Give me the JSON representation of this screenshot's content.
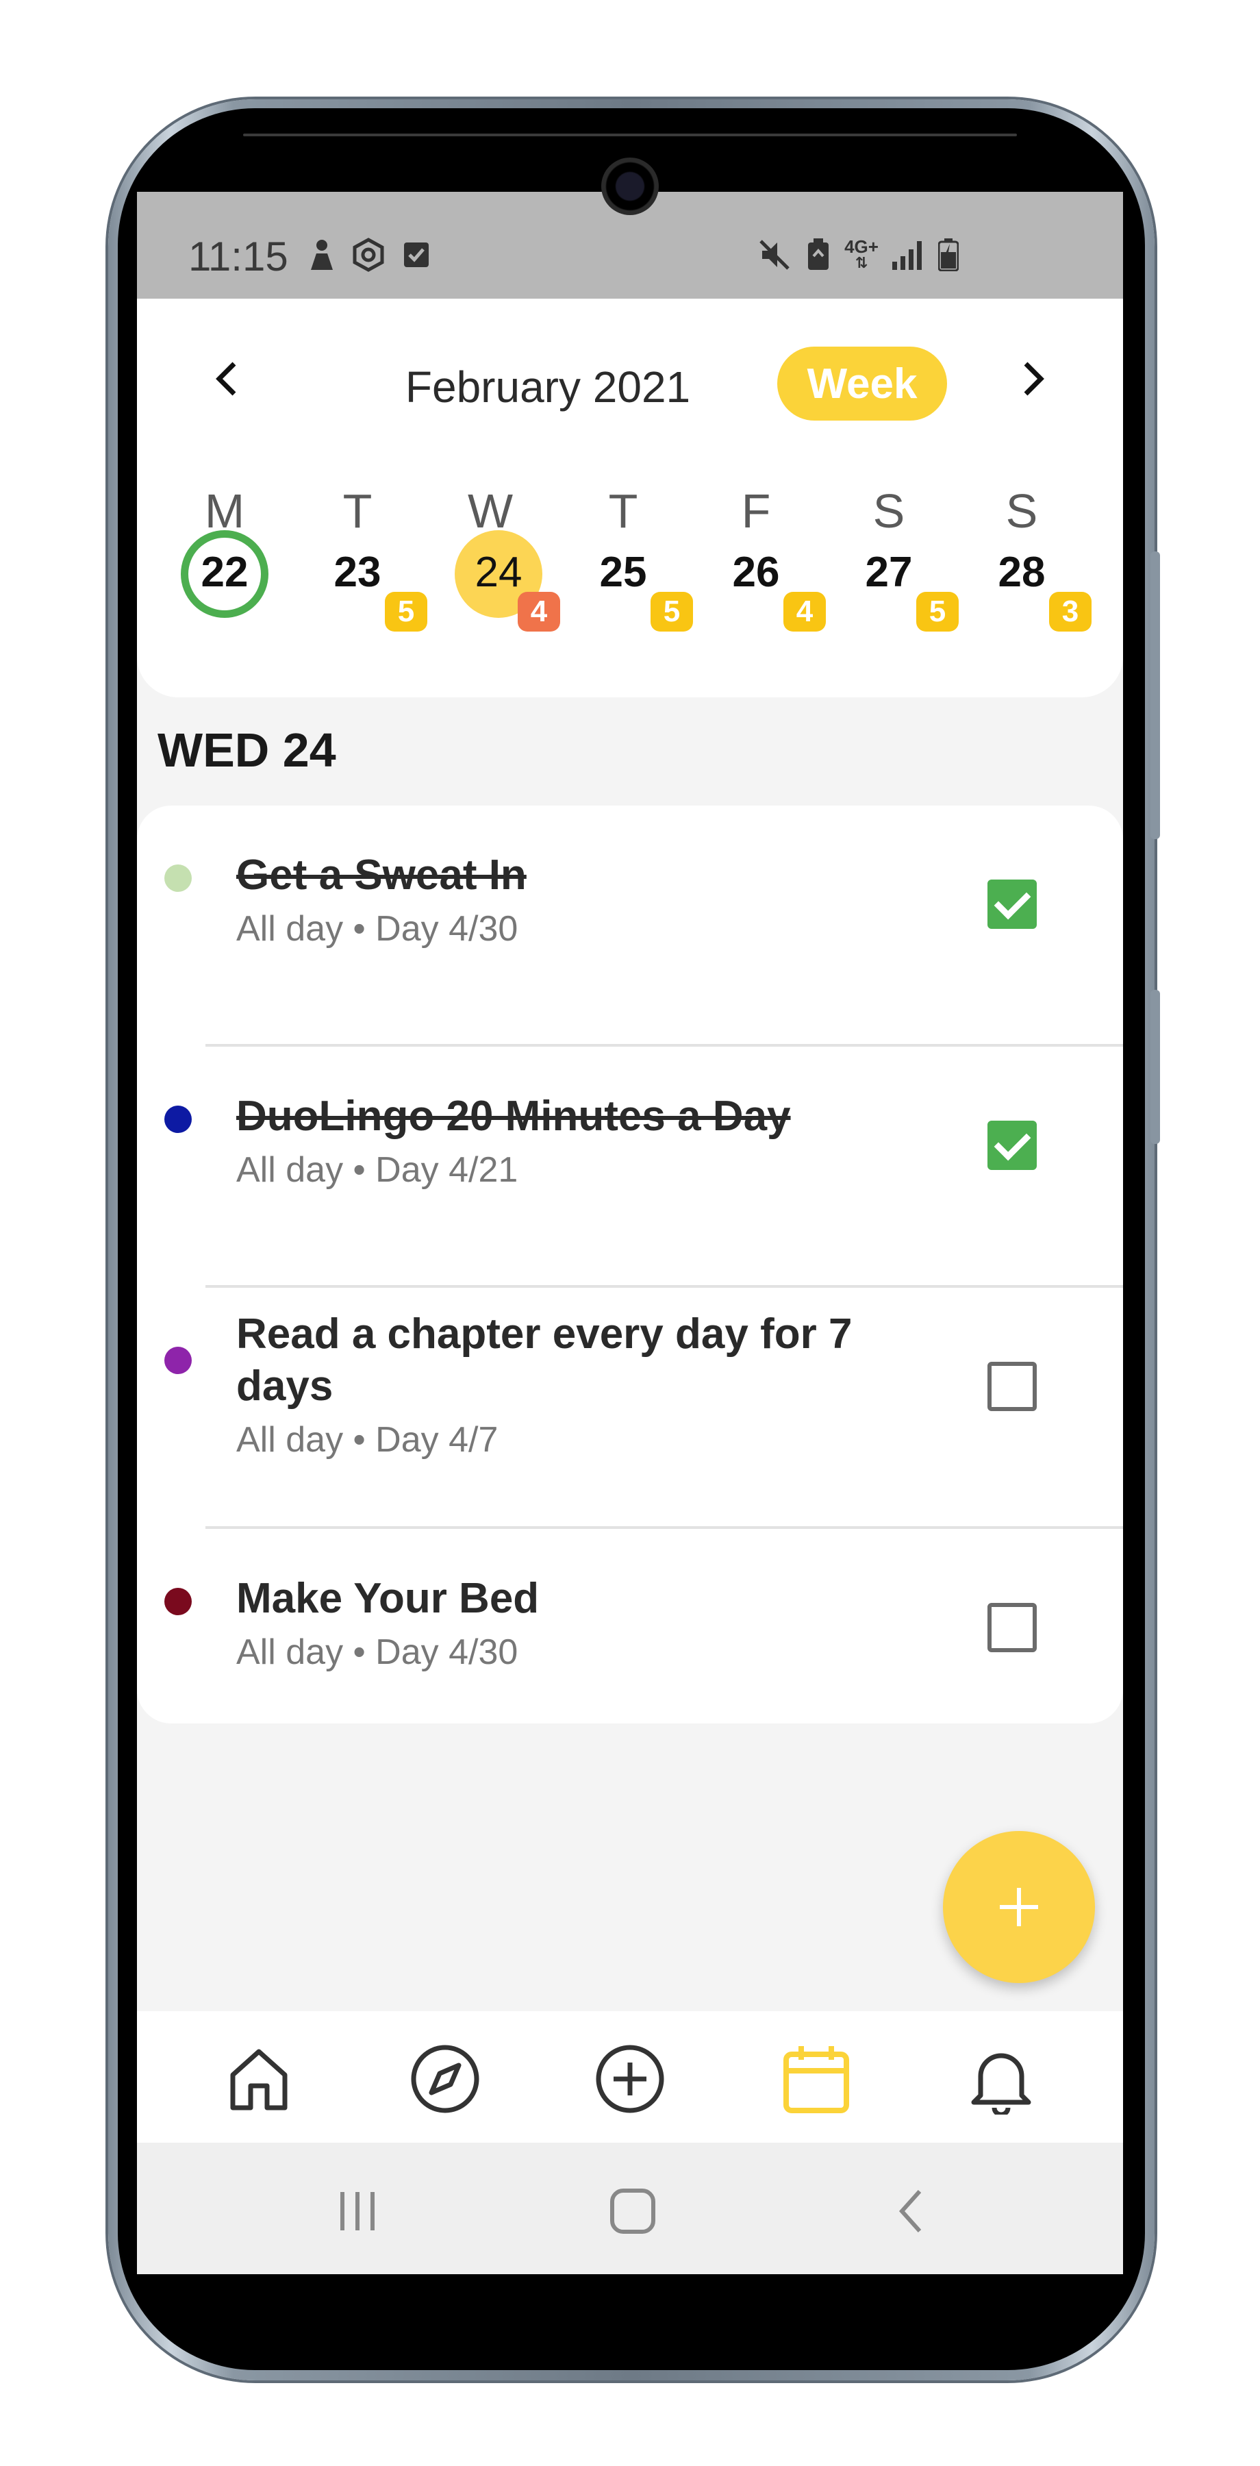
{
  "status_bar": {
    "time": "11:15",
    "left_icons": [
      "person-alert-icon",
      "hexagon-settings-icon",
      "checkbox-icon"
    ],
    "right_icons": [
      "mute-icon",
      "battery-saver-icon",
      "network-4g-icon",
      "signal-icon",
      "battery-icon"
    ],
    "network_label": "4G+"
  },
  "calendar": {
    "month_title": "February 2021",
    "view_toggle_label": "Week",
    "prev_icon": "chevron-left-icon",
    "next_icon": "chevron-right-icon",
    "days": [
      {
        "letter": "M",
        "number": "22",
        "badge": null,
        "state": "today"
      },
      {
        "letter": "T",
        "number": "23",
        "badge": "5",
        "state": "normal"
      },
      {
        "letter": "W",
        "number": "24",
        "badge": "4",
        "state": "selected"
      },
      {
        "letter": "T",
        "number": "25",
        "badge": "5",
        "state": "normal"
      },
      {
        "letter": "F",
        "number": "26",
        "badge": "4",
        "state": "normal"
      },
      {
        "letter": "S",
        "number": "27",
        "badge": "5",
        "state": "normal"
      },
      {
        "letter": "S",
        "number": "28",
        "badge": "3",
        "state": "normal"
      }
    ]
  },
  "section_label": "WED 24",
  "tasks": [
    {
      "title": "Get a Sweat In",
      "subtitle": "All day • Day 4/30",
      "color": "#c5e0b0",
      "completed": true
    },
    {
      "title": "DuoLingo 20 Minutes a Day",
      "subtitle": "All day • Day 4/21",
      "color": "#0d1aa3",
      "completed": true
    },
    {
      "title": "Read a chapter every day for 7 days",
      "subtitle": "All day • Day 4/7",
      "color": "#8e24aa",
      "completed": false
    },
    {
      "title": "Make Your Bed",
      "subtitle": "All day • Day 4/30",
      "color": "#7a0a1e",
      "completed": false
    }
  ],
  "fab_icon": "plus-icon",
  "bottom_nav": [
    {
      "icon": "home-icon",
      "active": false
    },
    {
      "icon": "compass-icon",
      "active": false
    },
    {
      "icon": "add-circle-icon",
      "active": false
    },
    {
      "icon": "calendar-icon",
      "active": true
    },
    {
      "icon": "bell-icon",
      "active": false
    }
  ],
  "system_nav": [
    "recents-icon",
    "home-button-icon",
    "back-icon"
  ],
  "colors": {
    "accent": "#fbd339",
    "today_ring": "#4cae4f",
    "checkbox_on": "#4caf50",
    "badge": "#f9c513",
    "badge_selected": "#f0734a"
  }
}
